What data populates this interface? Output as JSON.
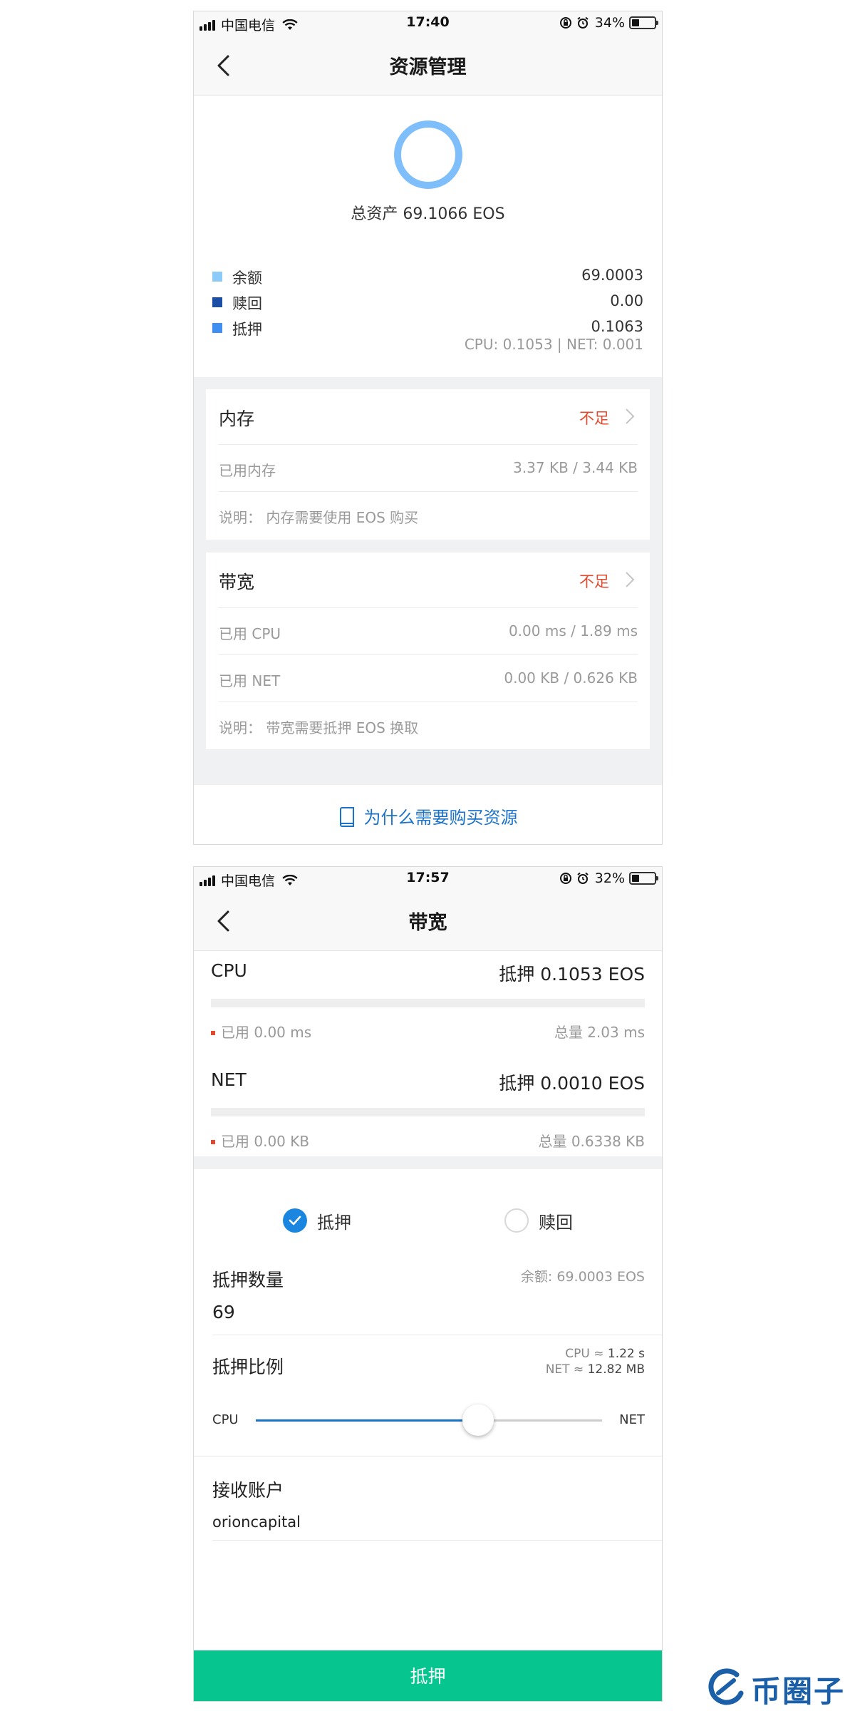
{
  "screen1": {
    "status": {
      "carrier": "中国电信",
      "time": "17:40",
      "battery": "34%",
      "battery_level": 0.34
    },
    "nav": {
      "title": "资源管理"
    },
    "summary": {
      "total": "总资产 69.1066 EOS"
    },
    "legend": [
      {
        "label": "余额",
        "value": "69.0003",
        "color": "#8ccaf9"
      },
      {
        "label": "赎回",
        "value": "0.00",
        "color": "#1b4fa7"
      },
      {
        "label": "抵押",
        "value": "0.1063",
        "color": "#3f8ff0"
      }
    ],
    "cpu_net": "CPU: 0.1053 | NET: 0.001",
    "memory": {
      "title": "内存",
      "status": "不足",
      "rows": [
        {
          "label": "已用内存",
          "value": "3.37 KB / 3.44 KB"
        },
        {
          "label": "说明： 内存需要使用 EOS 购买",
          "value": ""
        }
      ]
    },
    "bandwidth": {
      "title": "带宽",
      "status": "不足",
      "rows": [
        {
          "label": "已用 CPU",
          "value": "0.00 ms / 1.89 ms"
        },
        {
          "label": "已用 NET",
          "value": "0.00 KB / 0.626 KB"
        },
        {
          "label": "说明： 带宽需要抵押 EOS 换取",
          "value": ""
        }
      ]
    },
    "why_link": "为什么需要购买资源"
  },
  "screen2": {
    "status": {
      "carrier": "中国电信",
      "time": "17:57",
      "battery": "32%",
      "battery_level": 0.32
    },
    "nav": {
      "title": "带宽"
    },
    "cpu": {
      "name": "CPU",
      "stake": "抵押 0.1053 EOS",
      "used": "已用 0.00 ms",
      "total": "总量 2.03 ms"
    },
    "net": {
      "name": "NET",
      "stake": "抵押 0.0010 EOS",
      "used": "已用 0.00 KB",
      "total": "总量 0.6338 KB"
    },
    "mode": {
      "stake_label": "抵押",
      "redeem_label": "赎回",
      "selected": "抵押"
    },
    "amount": {
      "label": "抵押数量",
      "balance": "余额: 69.0003 EOS",
      "value": "69"
    },
    "ratio": {
      "label": "抵押比例",
      "cpu_estimate_prefix": "CPU ≈ ",
      "cpu_estimate": "1.22 s",
      "net_estimate_prefix": "NET ≈ ",
      "net_estimate": "12.82 MB",
      "left_label": "CPU",
      "right_label": "NET",
      "position": 0.64
    },
    "receiver": {
      "label": "接收账户",
      "value": "orioncapital"
    },
    "submit": "抵押"
  },
  "watermark": {
    "text": "币圈子"
  },
  "colors": {
    "accent_blue": "#1a72c9",
    "warning_red": "#e24a2f",
    "button_green": "#06c58f",
    "ring_blue": "#7ebefa"
  }
}
